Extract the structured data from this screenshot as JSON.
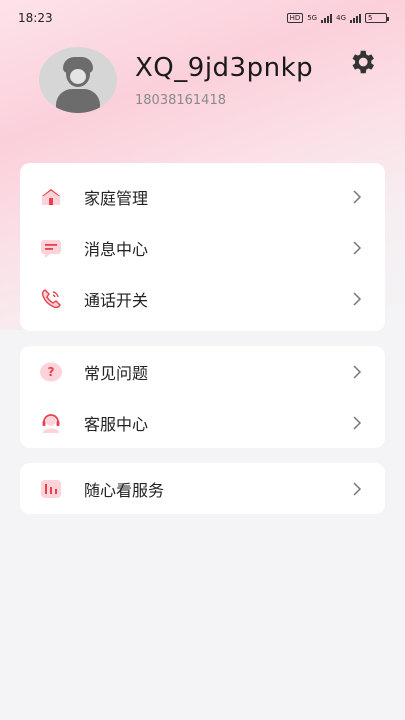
{
  "status_bar": {
    "time": "18:23",
    "hd": "HD",
    "sim": "5G",
    "network": "4G",
    "battery": "5"
  },
  "profile": {
    "username": "XQ_9jd3pnkp",
    "phone": "18038161418"
  },
  "menu_groups": [
    {
      "items": [
        {
          "label": "家庭管理",
          "icon": "home-icon"
        },
        {
          "label": "消息中心",
          "icon": "message-icon"
        },
        {
          "label": "通话开关",
          "icon": "phone-icon"
        }
      ]
    },
    {
      "items": [
        {
          "label": "常见问题",
          "icon": "question-icon"
        },
        {
          "label": "客服中心",
          "icon": "headset-icon"
        }
      ]
    },
    {
      "items": [
        {
          "label": "随心看服务",
          "icon": "chart-icon"
        }
      ]
    }
  ],
  "colors": {
    "accent": "#e8404f",
    "accent_light": "#fbd3d8"
  }
}
